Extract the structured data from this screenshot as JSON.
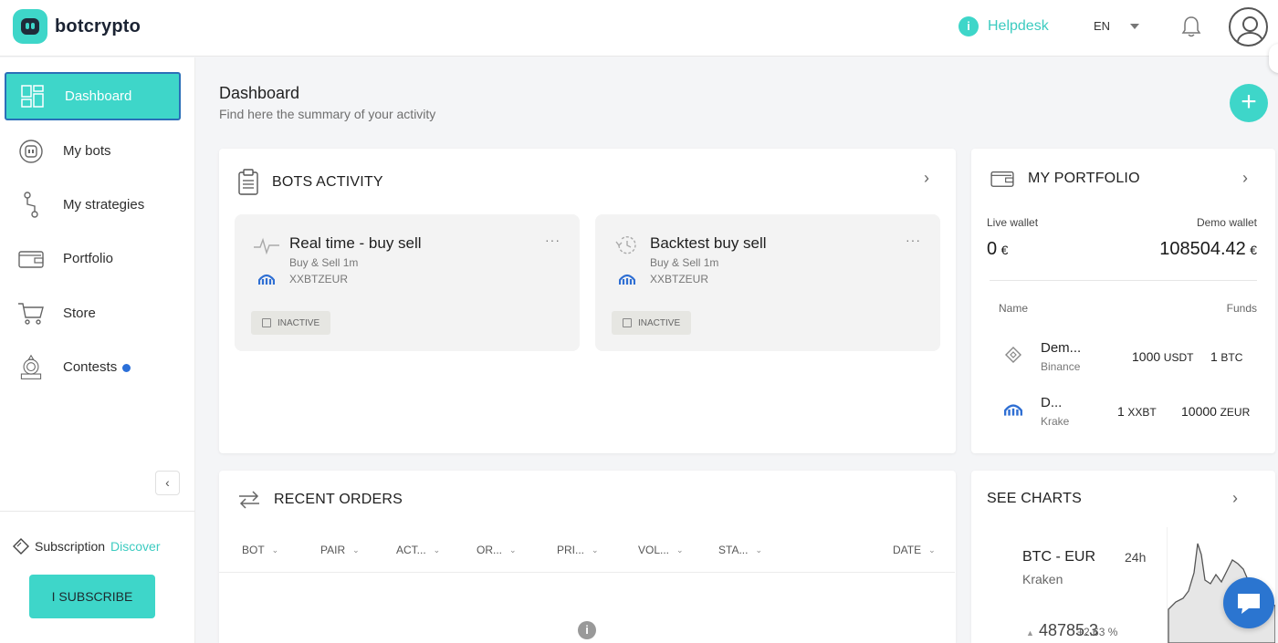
{
  "brand": {
    "name": "botcrypto"
  },
  "header": {
    "helpdesk": "Helpdesk",
    "language": "EN"
  },
  "sidebar": {
    "items": [
      {
        "label": "Dashboard"
      },
      {
        "label": "My bots"
      },
      {
        "label": "My strategies"
      },
      {
        "label": "Portfolio"
      },
      {
        "label": "Store"
      },
      {
        "label": "Contests"
      }
    ],
    "subscription_label": "Subscription",
    "subscription_link": "Discover",
    "subscribe_button": "I SUBSCRIBE"
  },
  "page": {
    "title": "Dashboard",
    "subtitle": "Find here the summary of your activity"
  },
  "bots_activity": {
    "title": "BOTS ACTIVITY",
    "bots": [
      {
        "name": "Real time - buy sell",
        "strategy": "Buy & Sell 1m",
        "pair": "XXBTZEUR",
        "status": "INACTIVE"
      },
      {
        "name": "Backtest buy sell",
        "strategy": "Buy & Sell 1m",
        "pair": "XXBTZEUR",
        "status": "INACTIVE"
      }
    ]
  },
  "portfolio": {
    "title": "MY PORTFOLIO",
    "live_wallet_label": "Live wallet",
    "live_wallet_value": "0",
    "demo_wallet_label": "Demo wallet",
    "demo_wallet_value": "108504.42",
    "currency": "€",
    "col_name": "Name",
    "col_funds": "Funds",
    "rows": [
      {
        "name": "Dem...",
        "exchange": "Binance",
        "fund1": "1000",
        "fund1_unit": "USDT",
        "fund2": "1",
        "fund2_unit": "BTC"
      },
      {
        "name": "D...",
        "exchange": "Krake",
        "fund1": "1",
        "fund1_unit": "XXBT",
        "fund2": "10000",
        "fund2_unit": "ZEUR"
      }
    ]
  },
  "recent_orders": {
    "title": "RECENT ORDERS",
    "columns": [
      "BOT",
      "PAIR",
      "ACT...",
      "OR...",
      "PRI...",
      "VOL...",
      "STA...",
      "DATE"
    ]
  },
  "charts": {
    "title": "SEE CHARTS",
    "pair": "BTC - EUR",
    "exchange": "Kraken",
    "period": "24h",
    "price": "48785.3",
    "change": "+2.63 %"
  },
  "colors": {
    "accent": "#3ed6c9",
    "active_border": "#2b6fb8",
    "notification_dot": "#2b6fd8",
    "chat": "#2b75d0"
  }
}
